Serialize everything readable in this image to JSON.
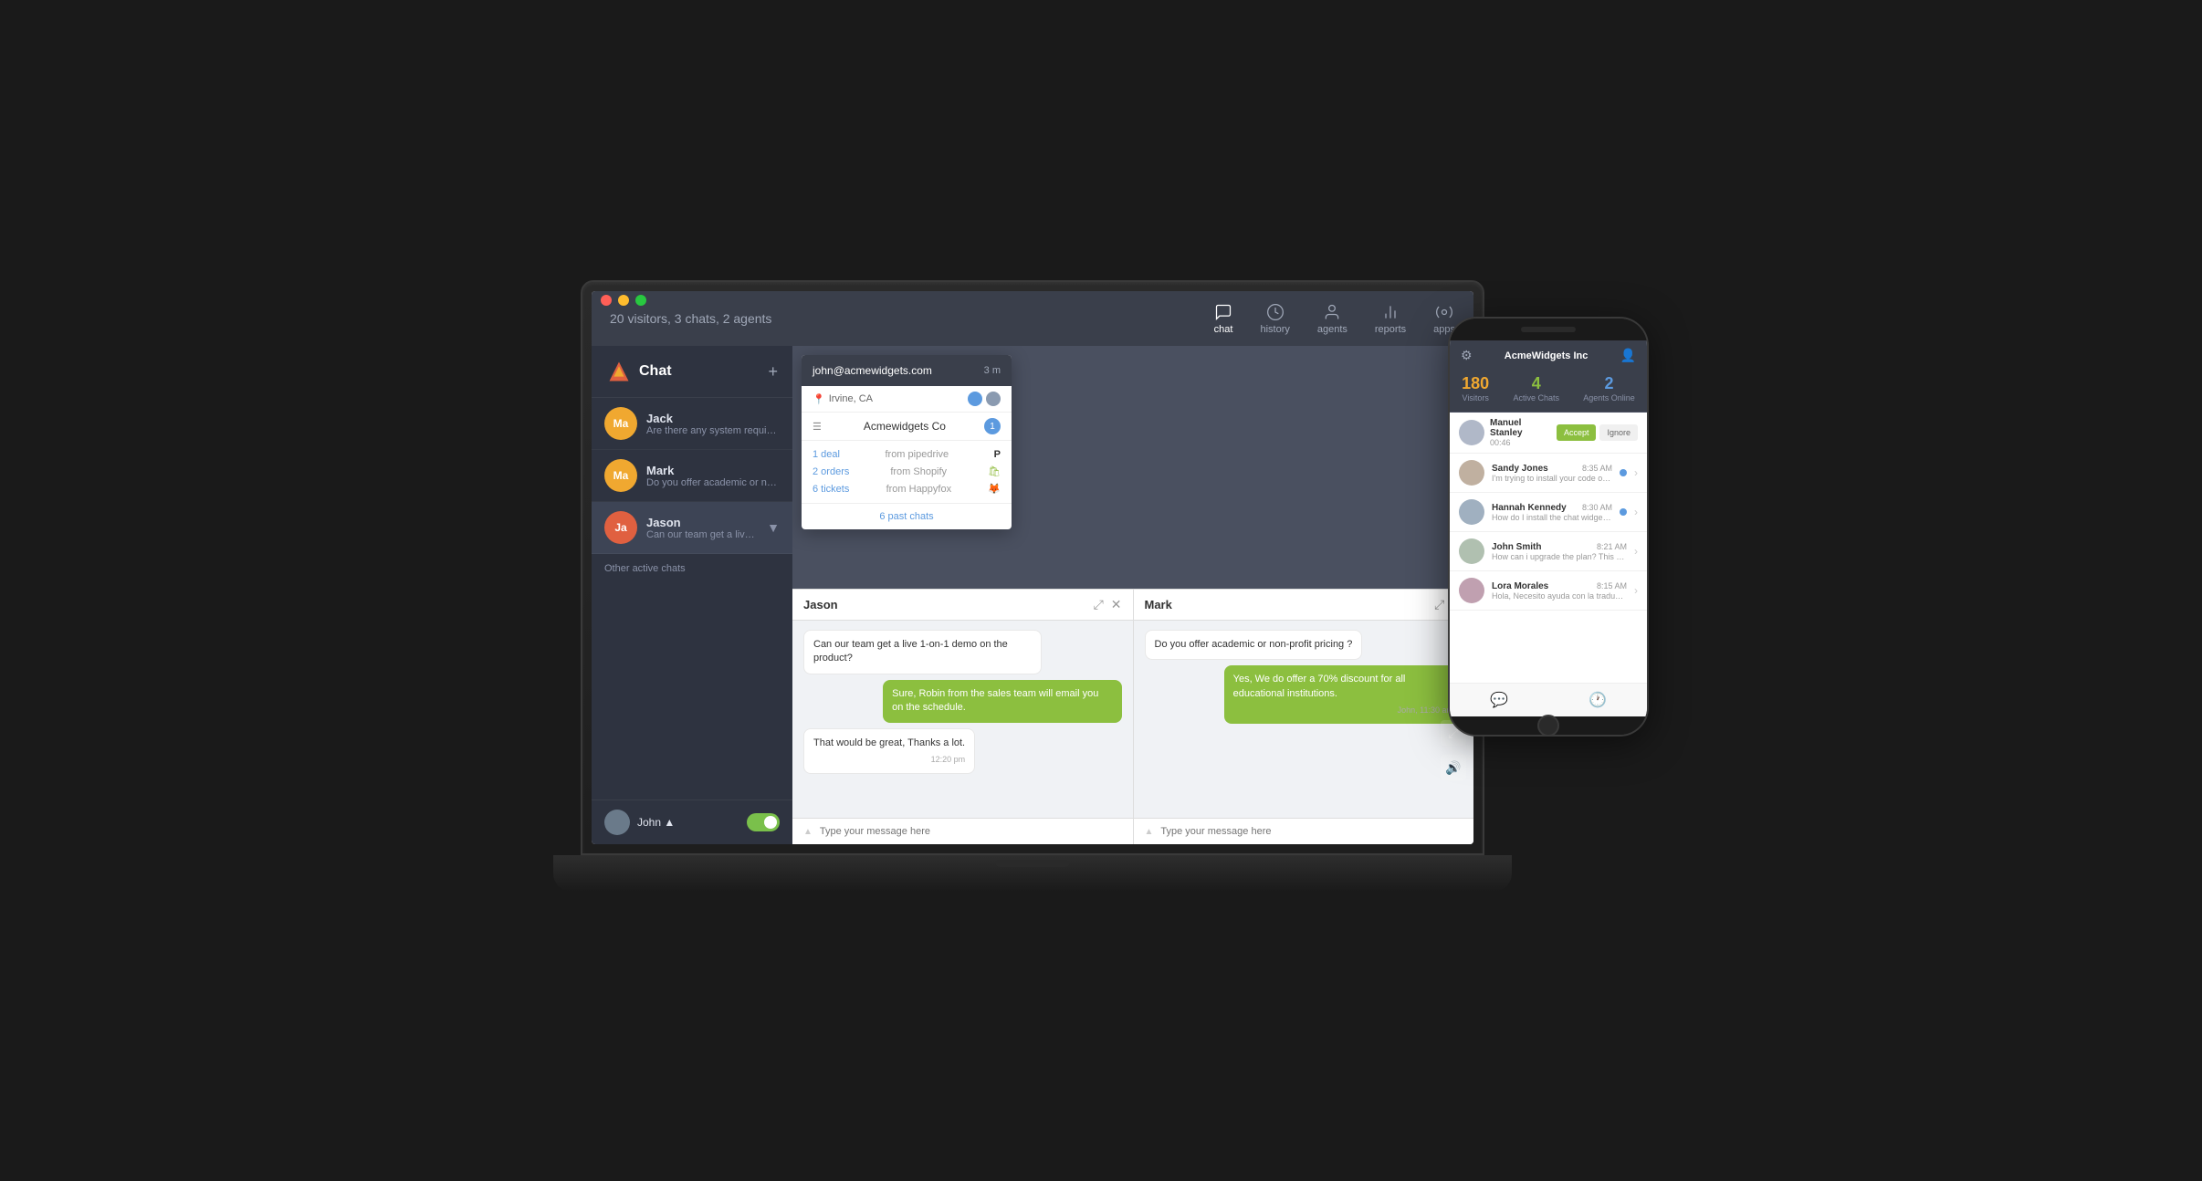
{
  "scene": {
    "background": "#1a1a1a"
  },
  "laptop": {
    "traffic_lights": [
      "red",
      "yellow",
      "green"
    ],
    "top_nav": {
      "visitors_info": "20 visitors, 3 chats, 2 agents",
      "nav_items": [
        {
          "id": "chat",
          "label": "chat",
          "active": true
        },
        {
          "id": "history",
          "label": "history",
          "active": false
        },
        {
          "id": "agents",
          "label": "agents",
          "active": false
        },
        {
          "id": "reports",
          "label": "reports",
          "active": false
        },
        {
          "id": "apps",
          "label": "apps",
          "active": false
        }
      ]
    },
    "sidebar": {
      "brand": "Chat",
      "plus_label": "+",
      "chats": [
        {
          "name": "Jack",
          "preview": "Are there any system requirem...",
          "avatar_initials": "Ma",
          "avatar_color": "yellow",
          "active": false
        },
        {
          "name": "Mark",
          "preview": "Do you offer academic or non-...",
          "avatar_initials": "Ma",
          "avatar_color": "yellow",
          "active": false
        },
        {
          "name": "Jason",
          "preview": "Can our team get a live 1-on-...",
          "avatar_initials": "Ja",
          "avatar_color": "orange",
          "active": true
        }
      ],
      "other_chats_label": "Other active chats",
      "agent_name": "John",
      "agent_status_toggle": true
    },
    "customer_card": {
      "email": "john@acmewidgets.com",
      "time": "3 m",
      "location": "Irvine, CA",
      "company": "Acmewidgets Co",
      "company_badge": "1",
      "integrations": [
        {
          "label": "1 deal",
          "source": "from pipedrive",
          "icon": "P"
        },
        {
          "label": "2 orders",
          "source": "from Shopify",
          "icon": "S"
        },
        {
          "label": "6 tickets",
          "source": "from Happyfox",
          "icon": "H"
        }
      ],
      "past_chats": "6 past chats"
    },
    "chat_panel_jason": {
      "title": "Jason",
      "messages": [
        {
          "type": "incoming",
          "text": "Can our team get a live 1-on-1 demo on the product?"
        },
        {
          "type": "outgoing",
          "text": "Sure, Robin from the sales team will email you on the schedule."
        },
        {
          "type": "incoming",
          "text": "That would be great, Thanks a lot.",
          "time": "12:20 pm"
        }
      ],
      "input_placeholder": "Type your message here"
    },
    "chat_panel_mark": {
      "title": "Mark",
      "messages": [
        {
          "type": "incoming",
          "text": "Do you offer academic or non-profit pricing ?"
        },
        {
          "type": "outgoing",
          "text": "Yes, We do offer a 70% discount for all educational institutions.",
          "time": "John, 11:30 am"
        }
      ],
      "input_placeholder": "Type your message here"
    }
  },
  "phone": {
    "company": "AcmeWidgets Inc",
    "stats": {
      "visitors": {
        "num": "180",
        "label": "Visitors"
      },
      "active_chats": {
        "num": "4",
        "label": "Active Chats"
      },
      "agents_online": {
        "num": "2",
        "label": "Agents Online"
      }
    },
    "incoming": {
      "name": "Manuel Stanley",
      "time": "00:46",
      "accept_label": "Accept",
      "ignore_label": "Ignore"
    },
    "chats": [
      {
        "name": "Sandy Jones",
        "time": "8:35 AM",
        "preview": "I'm trying to install your code on our...",
        "has_dot": true
      },
      {
        "name": "Hannah Kennedy",
        "time": "8:30 AM",
        "preview": "How do I install the chat widget on my...",
        "has_dot": true
      },
      {
        "name": "John Smith",
        "time": "8:21 AM",
        "preview": "How can i upgrade the plan? This app ...",
        "has_dot": false
      },
      {
        "name": "Lora Morales",
        "time": "8:15 AM",
        "preview": "Hola, Necesito ayuda con la traducció...",
        "has_dot": false
      }
    ],
    "footer_tabs": [
      {
        "id": "chat",
        "active": true
      },
      {
        "id": "history",
        "active": false
      }
    ]
  }
}
